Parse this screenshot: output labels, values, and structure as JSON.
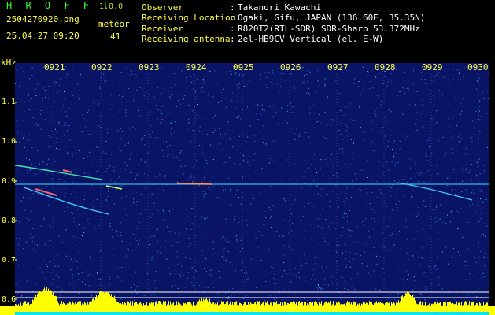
{
  "header": {
    "app_name": "H R O F F T",
    "version": "1.0.0",
    "filename": "2504270920.png",
    "datetime": "25.04.27 09:20",
    "meteor_label": "meteor",
    "meteor_count": "41"
  },
  "info": [
    {
      "label": "Observer",
      "sep": ":",
      "value": "Takanori Kawachi"
    },
    {
      "label": "Receiving Location",
      "sep": ":",
      "value": "Ogaki, Gifu, JAPAN (136.60E, 35.35N)"
    },
    {
      "label": "Receiver",
      "sep": ":",
      "value": "R820T2(RTL-SDR) SDR-Sharp 53.372MHz"
    },
    {
      "label": "Receiving antenna",
      "sep": ":",
      "value": "2el-HB9CV Vertical (el. E-W)"
    }
  ],
  "spectrogram": {
    "freq_unit": "kHz",
    "freq_labels": [
      "1.1",
      "1.0",
      "0.9",
      "0.8",
      "0.7",
      "0.6"
    ],
    "time_labels": [
      "0921",
      "0922",
      "0923",
      "0924",
      "0925",
      "0926",
      "0927",
      "0928",
      "0929",
      "0930"
    ]
  },
  "colors": {
    "background": "#000000",
    "noise_base": "#0a1464",
    "label_yellow": "#ffff44",
    "title_green": "#33ff33",
    "meter_yellow": "#ffff00",
    "meter_cyan": "#00e5ff"
  }
}
